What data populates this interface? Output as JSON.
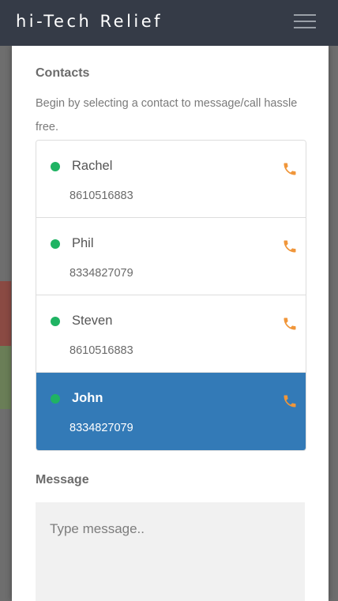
{
  "navbar": {
    "brand": "hi-Tech Relief",
    "menu_icon": "hamburger-menu-icon"
  },
  "contacts": {
    "title": "Contacts",
    "description": "Begin by selecting a contact to message/call hassle free.",
    "status_color": "#1fb363",
    "call_icon": "phone-icon",
    "call_icon_color": "#f0963a",
    "active_color": "#337ab7",
    "items": [
      {
        "name": "Rachel",
        "phone": "8610516883",
        "active": false
      },
      {
        "name": "Phil",
        "phone": "8334827079",
        "active": false
      },
      {
        "name": "Steven",
        "phone": "8610516883",
        "active": false
      },
      {
        "name": "John",
        "phone": "8334827079",
        "active": true
      }
    ]
  },
  "message": {
    "title": "Message",
    "placeholder": "Type message..",
    "value": ""
  }
}
